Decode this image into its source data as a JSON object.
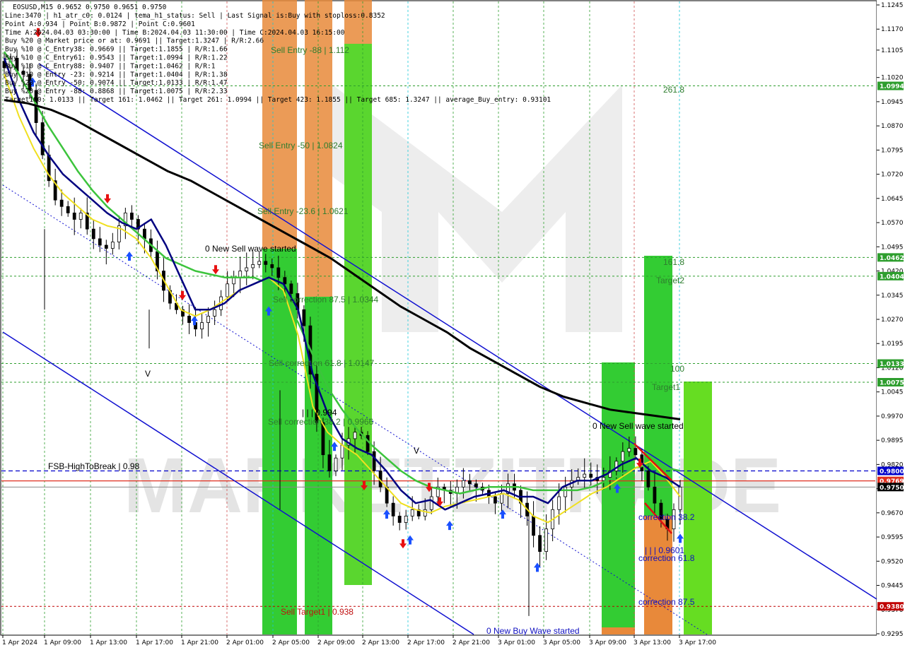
{
  "symbol_header": "EOSUSD,M15  0.9652 0.9750 0.9651 0.9750",
  "info_lines": [
    "Line:3470 | h1_atr_c0: 0.0124 | tema_h1_status: Sell | Last Signal is:Buy with stoploss:0.8352",
    "Point A:0.934 | Point B:0.9872 | Point C:0.9601",
    "Time A:2024.04.03 03:30:00 | Time B:2024.04.03 11:30:00 | Time C:2024.04.03 16:15:00",
    "Buy %20 @ Market price or at: 0.9691 || Target:1.3247 | R/R:2.66",
    "Buy %10 @ C_Entry38: 0.9669 || Target:1.1855 | R/R:1.66",
    "Buy %10 @ C_Entry61: 0.9543 || Target:1.0994 | R/R:1.22",
    "Buy %10 @ C_Entry88: 0.9407 || Target:1.0462 | R/R:1",
    "Buy %10 @ Entry -23: 0.9214 || Target:1.0404 | R/R:1.38",
    "Buy %20 @ Entry -50: 0.9074 || Target:1.0133 | R/R:1.47",
    "Buy %20 @ Entry -88: 0.8868 || Target:1.0075 | R/R:2.33",
    "Target100: 1.0133 || Target 161: 1.0462 || Target 261: 1.0994 || Target 423: 1.1855 || Target 685: 1.3247 || average_Buy_entry: 0.93101"
  ],
  "watermark": "MARKETZITRADE",
  "annotations": {
    "sell_entry_88": "Sell Entry -88 | 1.112",
    "sell_entry_50": "Sell Entry -50 | 1.0824",
    "sell_entry_23": "Sell Entry -23.6 | 1.0621",
    "new_sell_wave_1": "0 New Sell wave started",
    "sell_corr_875": "Sell correction 87.5 | 1.0344",
    "sell_corr_618": "Sell correction 61.8 | 1.0147",
    "point_b_label": "| | | 0.994",
    "sell_corr_382": "Sell correction 38.2 | 0.9966",
    "fsb_label": "FSB-HighToBreak | 0.98",
    "sell_target1": "Sell Target1 | 0.938",
    "new_buy_wave": "0 New Buy Wave started",
    "new_sell_wave_2": "0 New Sell wave started",
    "fib_2618": "261.8",
    "fib_1618": "161.8",
    "target2": "Target2",
    "fib_100": "100",
    "target1": "Target1",
    "corr_382": "correction 38.2",
    "point_c_label": "| | | 0.9601",
    "corr_618": "correction 61.8",
    "corr_875": "correction 87.5",
    "v_mark": "V"
  },
  "chart_data": {
    "type": "candlestick",
    "symbol": "EOSUSD",
    "timeframe": "M15",
    "ylim": [
      0.9295,
      1.1245
    ],
    "y_ticks": [
      "1.1245",
      "1.1170",
      "1.1105",
      "1.1020",
      "1.0945",
      "1.0870",
      "1.0795",
      "1.0720",
      "1.0645",
      "1.0570",
      "1.0495",
      "1.0420",
      "1.0345",
      "1.0270",
      "1.0195",
      "1.0120",
      "1.0045",
      "0.9970",
      "0.9895",
      "0.9820",
      "0.9745",
      "0.9670",
      "0.9595",
      "0.9520",
      "0.9445",
      "0.9370",
      "0.9295"
    ],
    "x_ticks": [
      "1 Apr 2024",
      "1 Apr 09:00",
      "1 Apr 13:00",
      "1 Apr 17:00",
      "1 Apr 21:00",
      "2 Apr 01:00",
      "2 Apr 05:00",
      "2 Apr 09:00",
      "2 Apr 13:00",
      "2 Apr 17:00",
      "2 Apr 21:00",
      "3 Apr 01:00",
      "3 Apr 05:00",
      "3 Apr 09:00",
      "3 Apr 13:00",
      "3 Apr 17:00"
    ],
    "price_tags": [
      {
        "value": "1.0994",
        "color": "#2e9e2e"
      },
      {
        "value": "1.0462",
        "color": "#2e9e2e"
      },
      {
        "value": "1.0404",
        "color": "#2e9e2e"
      },
      {
        "value": "1.0133",
        "color": "#2e9e2e"
      },
      {
        "value": "1.0075",
        "color": "#2e9e2e"
      },
      {
        "value": "0.9800",
        "color": "#0000cc"
      },
      {
        "value": "0.9769",
        "color": "#e03020"
      },
      {
        "value": "0.9750",
        "color": "#000000"
      },
      {
        "value": "0.9380",
        "color": "#c00000"
      }
    ],
    "close_series": [
      1.105,
      1.108,
      1.104,
      1.103,
      1.098,
      1.088,
      1.078,
      1.07,
      1.064,
      1.062,
      1.06,
      1.058,
      1.06,
      1.055,
      1.052,
      1.05,
      1.049,
      1.051,
      1.056,
      1.06,
      1.058,
      1.055,
      1.052,
      1.048,
      1.042,
      1.036,
      1.032,
      1.03,
      1.028,
      1.026,
      1.024,
      1.026,
      1.028,
      1.03,
      1.034,
      1.038,
      1.04,
      1.042,
      1.043,
      1.044,
      1.045,
      1.044,
      1.043,
      1.04,
      1.038,
      1.035,
      1.03,
      1.025,
      1.01,
      0.995,
      0.985,
      0.98,
      0.984,
      0.988,
      0.99,
      0.992,
      0.991,
      0.986,
      0.98,
      0.975,
      0.97,
      0.966,
      0.964,
      0.966,
      0.968,
      0.966,
      0.968,
      0.972,
      0.975,
      0.974,
      0.973,
      0.975,
      0.977,
      0.976,
      0.975,
      0.974,
      0.972,
      0.97,
      0.973,
      0.976,
      0.974,
      0.97,
      0.966,
      0.96,
      0.955,
      0.962,
      0.968,
      0.972,
      0.975,
      0.977,
      0.978,
      0.979,
      0.978,
      0.977,
      0.978,
      0.98,
      0.983,
      0.986,
      0.987,
      0.985,
      0.98,
      0.975,
      0.97,
      0.965,
      0.962,
      0.968,
      0.975
    ],
    "ma200": [
      1.095,
      1.094,
      1.092,
      1.089,
      1.085,
      1.081,
      1.077,
      1.073,
      1.07,
      1.066,
      1.062,
      1.058,
      1.054,
      1.05,
      1.046,
      1.041,
      1.036,
      1.031,
      1.027,
      1.023,
      1.018,
      1.014,
      1.01,
      1.006,
      1.003,
      1.001,
      0.999,
      0.998,
      0.997,
      0.996
    ],
    "ma_blue": [
      1.108,
      1.095,
      1.085,
      1.078,
      1.072,
      1.068,
      1.064,
      1.06,
      1.057,
      1.055,
      1.058,
      1.05,
      1.04,
      1.03,
      1.03,
      1.032,
      1.036,
      1.038,
      1.04,
      1.038,
      1.03,
      1.01,
      0.998,
      0.99,
      0.987,
      0.985,
      0.98,
      0.974,
      0.97,
      0.971,
      0.968,
      0.97,
      0.972,
      0.973,
      0.974,
      0.972,
      0.972,
      0.97,
      0.975,
      0.977,
      0.977,
      0.979,
      0.982,
      0.984,
      0.98,
      0.978,
      0.975
    ],
    "ma_yellow": [
      1.103,
      1.09,
      1.08,
      1.072,
      1.066,
      1.062,
      1.058,
      1.056,
      1.055,
      1.052,
      1.046,
      1.038,
      1.03,
      1.028,
      1.03,
      1.033,
      1.036,
      1.038,
      1.04,
      1.036,
      1.022,
      1.0,
      0.992,
      0.988,
      0.985,
      0.98,
      0.975,
      0.97,
      0.968,
      0.967,
      0.969,
      0.97,
      0.971,
      0.972,
      0.973,
      0.971,
      0.966,
      0.964,
      0.967,
      0.97,
      0.973,
      0.975,
      0.978,
      0.981,
      0.983,
      0.978,
      0.972
    ],
    "ma_green": [
      1.11,
      1.103,
      1.095,
      1.087,
      1.08,
      1.073,
      1.067,
      1.062,
      1.058,
      1.054,
      1.05,
      1.046,
      1.044,
      1.042,
      1.041,
      1.04,
      1.04,
      1.04,
      1.038,
      1.034,
      1.026,
      1.016,
      1.006,
      0.999,
      0.993,
      0.988,
      0.984,
      0.98,
      0.977,
      0.975,
      0.974,
      0.973,
      0.974,
      0.975,
      0.975,
      0.975,
      0.974,
      0.974,
      0.974,
      0.974,
      0.975,
      0.977,
      0.979,
      0.981,
      0.982,
      0.981,
      0.98
    ]
  }
}
